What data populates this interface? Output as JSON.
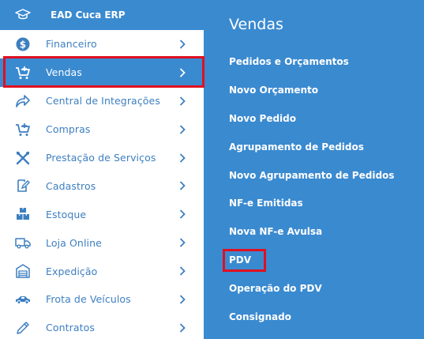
{
  "brand": {
    "title": "EAD Cuca ERP",
    "icon": "graduation-cap-icon"
  },
  "sidebar": {
    "items": [
      {
        "label": "Financeiro",
        "icon": "dollar-circle-icon",
        "active": false
      },
      {
        "label": "Vendas",
        "icon": "cart-plus-icon",
        "active": true
      },
      {
        "label": "Central de Integrações",
        "icon": "share-arrow-icon",
        "active": false
      },
      {
        "label": "Compras",
        "icon": "cart-plus-icon",
        "active": false
      },
      {
        "label": "Prestação de Serviços",
        "icon": "tools-icon",
        "active": false
      },
      {
        "label": "Cadastros",
        "icon": "edit-note-icon",
        "active": false
      },
      {
        "label": "Estoque",
        "icon": "boxes-icon",
        "active": false
      },
      {
        "label": "Loja Online",
        "icon": "truck-icon",
        "active": false
      },
      {
        "label": "Expedição",
        "icon": "warehouse-icon",
        "active": false
      },
      {
        "label": "Frota de Veículos",
        "icon": "car-icon",
        "active": false
      },
      {
        "label": "Contratos",
        "icon": "pen-icon",
        "active": false
      }
    ]
  },
  "submenu": {
    "title": "Vendas",
    "items": [
      "Pedidos e Orçamentos",
      "Novo Orçamento",
      "Novo Pedido",
      "Agrupamento de Pedidos",
      "Novo Agrupamento de Pedidos",
      "NF-e Emitidas",
      "Nova NF-e Avulsa",
      "PDV",
      "Operação do PDV",
      "Consignado"
    ]
  },
  "colors": {
    "accent": "#3a8ad0",
    "menu_text": "#3d7fc0",
    "highlight": "#e01020",
    "white": "#ffffff"
  }
}
